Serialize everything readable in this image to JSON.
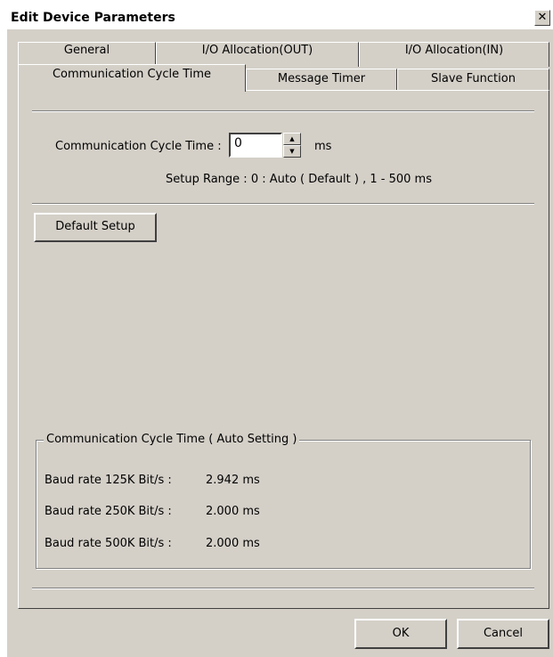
{
  "window": {
    "title": "Edit Device Parameters",
    "close_label": "✕"
  },
  "tabs_row1": [
    "General",
    "I/O Allocation(OUT)",
    "I/O Allocation(IN)"
  ],
  "tabs_row2": [
    "Communication Cycle Time",
    "Message Timer",
    "Slave Function"
  ],
  "cycle": {
    "label": "Communication Cycle Time :",
    "value": "0",
    "unit": "ms",
    "range": "Setup Range :   0 : Auto ( Default ) ,  1 - 500 ms"
  },
  "default_button": "Default Setup",
  "auto_group": {
    "title": "Communication Cycle Time ( Auto Setting )",
    "rows": [
      {
        "label": "Baud rate 125K Bit/s :",
        "value": "2.942 ms"
      },
      {
        "label": "Baud rate 250K Bit/s :",
        "value": "2.000 ms"
      },
      {
        "label": "Baud rate 500K Bit/s :",
        "value": "2.000 ms"
      }
    ]
  },
  "buttons": {
    "ok": "OK",
    "cancel": "Cancel"
  },
  "colors": {
    "face": "#d4d0c8",
    "shadow": "#404040",
    "highlight": "#ffffff"
  },
  "icons": {
    "close": "close-icon",
    "spin_up": "arrow-up-icon",
    "spin_down": "arrow-down-icon"
  }
}
